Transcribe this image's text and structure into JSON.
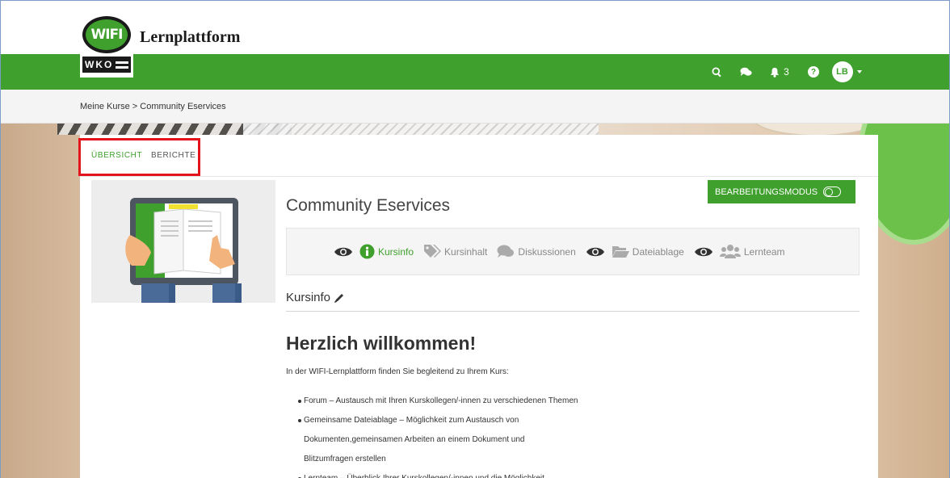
{
  "header": {
    "brand": "Lernplattform",
    "logo_text": "WIFI",
    "logo_sub": "WKO",
    "notifications_count": "3",
    "avatar_initials": "LB",
    "icons": [
      "search-icon",
      "chat-icon",
      "bell-icon",
      "help-icon"
    ],
    "accent": "#3fa02d"
  },
  "breadcrumb": "Meine Kurse > Community Eservices",
  "tabs": [
    "ÜBERSICHT",
    "BERICHTE"
  ],
  "course": {
    "title": "Community Eservices",
    "edit_button": "BEARBEITUNGSMODUS",
    "modules": [
      {
        "label": "Kursinfo",
        "icon": "info-icon",
        "visible": true
      },
      {
        "label": "Kursinhalt",
        "icon": "tag-icon",
        "visible": false
      },
      {
        "label": "Diskussionen",
        "icon": "comments-icon",
        "visible": false
      },
      {
        "label": "Dateiablage",
        "icon": "folder-icon",
        "visible": true
      },
      {
        "label": "Lernteam",
        "icon": "users-icon",
        "visible": true
      }
    ]
  },
  "content": {
    "section_title": "Kursinfo",
    "welcome": "Herzlich willkommen!",
    "intro": "In der WIFI-Lernplattform finden Sie begleitend zu Ihrem Kurs:",
    "bullets": [
      "Forum – Austausch mit Ihren Kurskollegen/-innen zu verschiedenen Themen",
      "Gemeinsame Dateiablage – Möglichkeit zum Austausch von",
      "Dokumenten,gemeinsamen Arbeiten an einem Dokument und",
      "Blitzumfragen erstellen",
      "Lernteam – Überblick Ihrer Kurskollegen/-innen und die Möglichkeit"
    ]
  }
}
